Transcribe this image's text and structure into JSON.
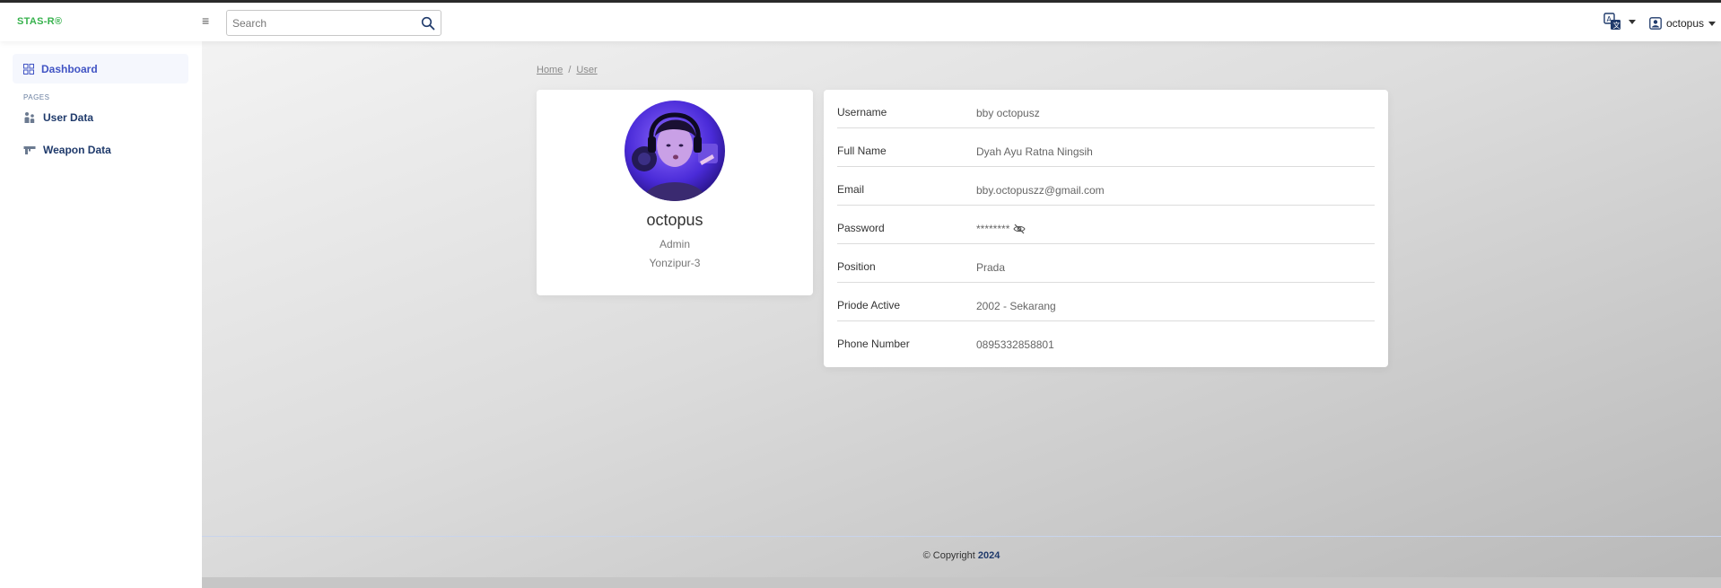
{
  "header": {
    "brand": "STAS-R®",
    "search_placeholder": "Search",
    "user_name": "octopus"
  },
  "sidebar": {
    "dashboard": "Dashboard",
    "section_heading": "PAGES",
    "items": [
      {
        "label": "User Data",
        "icon": "users-icon"
      },
      {
        "label": "Weapon Data",
        "icon": "weapon-icon"
      }
    ]
  },
  "breadcrumb": {
    "home": "Home",
    "sep": "/",
    "current": "User"
  },
  "profile": {
    "name": "octopus",
    "role": "Admin",
    "unit": "Yonzipur-3"
  },
  "details": {
    "username_label": "Username",
    "username": "bby octopusz",
    "fullname_label": "Full Name",
    "fullname": "Dyah Ayu Ratna Ningsih",
    "email_label": "Email",
    "email": "bby.octopuszz@gmail.com",
    "password_label": "Password",
    "password": "********",
    "position_label": "Position",
    "position": "Prada",
    "period_label": "Priode Active",
    "period": "2002 - Sekarang",
    "phone_label": "Phone Number",
    "phone": "0895332858801"
  },
  "footer": {
    "copyright": "© Copyright",
    "year": "2024"
  },
  "colors": {
    "brand": "#37b24d",
    "accent": "#4154c4",
    "nav_text": "#1f3a6b"
  }
}
